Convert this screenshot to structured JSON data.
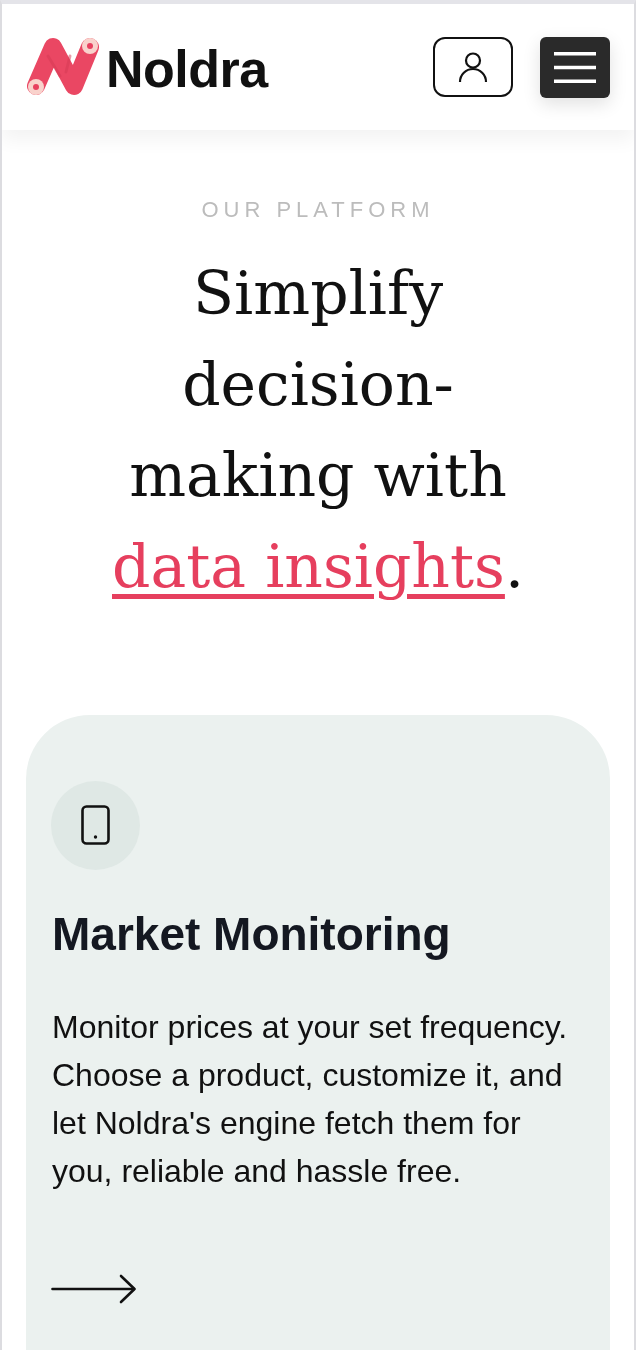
{
  "header": {
    "brand": "Noldra"
  },
  "hero": {
    "eyebrow": "OUR PLATFORM",
    "headline": "Simplify decision-making with",
    "headline_highlight": "data insights",
    "headline_end": "."
  },
  "feature_card": {
    "title": "Market Monitoring",
    "description": "Monitor prices at your set frequency. Choose a product, customize it, and let Noldra's engine fetch them for you, reliable and hassle free."
  }
}
